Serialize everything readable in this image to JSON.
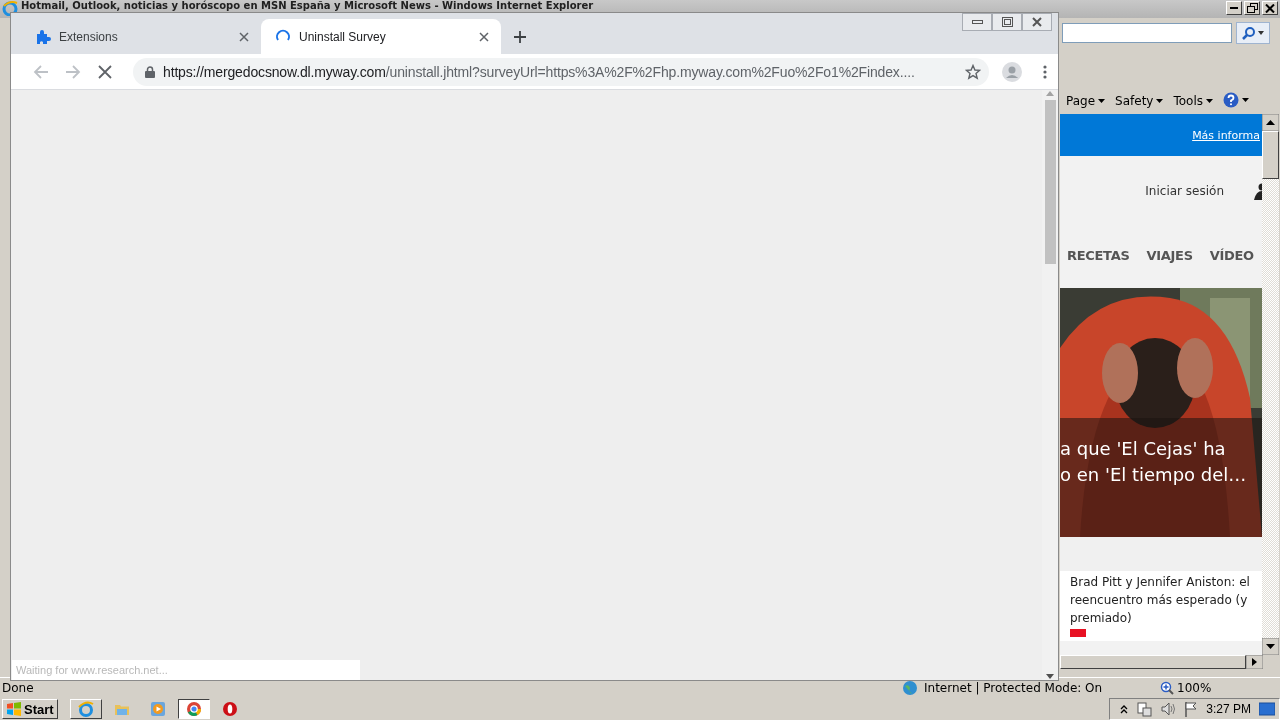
{
  "ie_window": {
    "title": "Hotmail, Outlook, noticias y horóscopo en MSN España y Microsoft News - Windows Internet Explorer",
    "command_bar": [
      "Page",
      "Safety",
      "Tools"
    ],
    "banner_link": "Más informa",
    "sign_in": "Iniciar sesión",
    "nav": [
      "RECETAS",
      "VIAJES",
      "VÍDEO"
    ],
    "hero_caption": [
      "a que 'El Cejas' ha",
      "o en 'El tiempo del…"
    ],
    "article": "Brad Pitt y Jennifer Aniston: el reencuentro más esperado (y premiado)",
    "status": "Done",
    "zone": "Internet | Protected Mode: On",
    "zoom": "100%"
  },
  "chrome_window": {
    "tabs": [
      {
        "title": "Extensions",
        "kind": "extensions",
        "selected": false
      },
      {
        "title": "Uninstall Survey",
        "kind": "loading",
        "selected": true
      }
    ],
    "url_host": "https://mergedocsnow.dl.myway.com",
    "url_path": "/uninstall.jhtml?surveyUrl=https%3A%2F%2Fhp.myway.com%2Fuo%2Fo1%2Findex....",
    "loading": true,
    "status_bubble": "Waiting for www.research.net..."
  },
  "taskbar": {
    "start": "Start",
    "apps": [
      {
        "kind": "ie",
        "selected": false
      },
      {
        "kind": "folder",
        "selected": false
      },
      {
        "kind": "media",
        "selected": false
      },
      {
        "kind": "chrome",
        "selected": true
      },
      {
        "kind": "opera",
        "selected": false
      }
    ],
    "clock": "3:27 PM"
  }
}
